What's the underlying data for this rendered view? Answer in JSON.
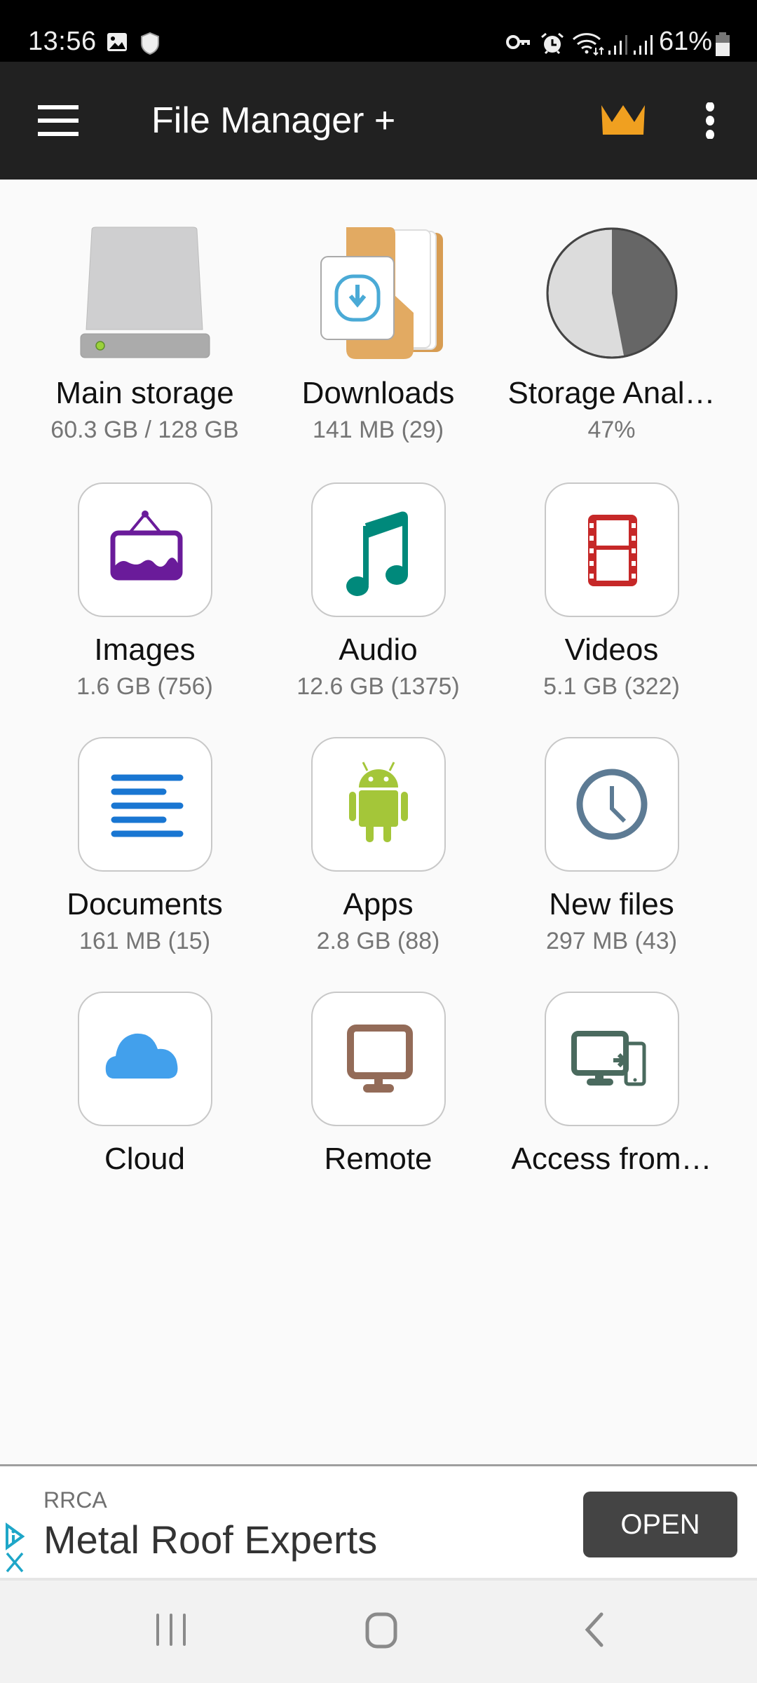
{
  "status_bar": {
    "time": "13:56",
    "left_icons": [
      "gallery-notification-icon",
      "shield-icon"
    ],
    "right_icons": [
      "vpn-key-icon",
      "alarm-icon",
      "wifi-icon",
      "signal-icon",
      "signal-icon"
    ],
    "battery_percent": "61%"
  },
  "app_bar": {
    "title": "File Manager +",
    "menu_icon": "hamburger-menu-icon",
    "premium_icon": "crown-icon",
    "overflow_icon": "more-vert-icon",
    "accent_color": "#F0A020"
  },
  "categories": [
    {
      "label": "Main storage",
      "sub": "60.3 GB / 128 GB",
      "icon": "hard-drive-icon"
    },
    {
      "label": "Downloads",
      "sub": "141 MB (29)",
      "icon": "download-folder-icon"
    },
    {
      "label": "Storage Anal…",
      "sub": "47%",
      "icon": "pie-chart-icon",
      "used_fraction": 0.47
    },
    {
      "label": "Images",
      "sub": "1.6 GB (756)",
      "icon": "image-frame-icon",
      "color": "#6A1B9A"
    },
    {
      "label": "Audio",
      "sub": "12.6 GB (1375)",
      "icon": "music-note-icon",
      "color": "#00897B"
    },
    {
      "label": "Videos",
      "sub": "5.1 GB (322)",
      "icon": "film-strip-icon",
      "color": "#C62828"
    },
    {
      "label": "Documents",
      "sub": "161 MB (15)",
      "icon": "document-lines-icon",
      "color": "#1976D2"
    },
    {
      "label": "Apps",
      "sub": "2.8 GB (88)",
      "icon": "android-icon",
      "color": "#A4C639"
    },
    {
      "label": "New files",
      "sub": "297 MB (43)",
      "icon": "clock-icon",
      "color": "#5D7B94"
    },
    {
      "label": "Cloud",
      "sub": "",
      "icon": "cloud-icon",
      "color": "#42A0EC"
    },
    {
      "label": "Remote",
      "sub": "",
      "icon": "monitor-icon",
      "color": "#936B58"
    },
    {
      "label": "Access from…",
      "sub": "",
      "icon": "pc-to-phone-icon",
      "color": "#4A6A5E"
    }
  ],
  "ad": {
    "advertiser": "RRCA",
    "headline": "Metal Roof Experts",
    "cta": "OPEN"
  },
  "nav_bar": [
    "recents-icon",
    "home-icon",
    "back-icon"
  ]
}
